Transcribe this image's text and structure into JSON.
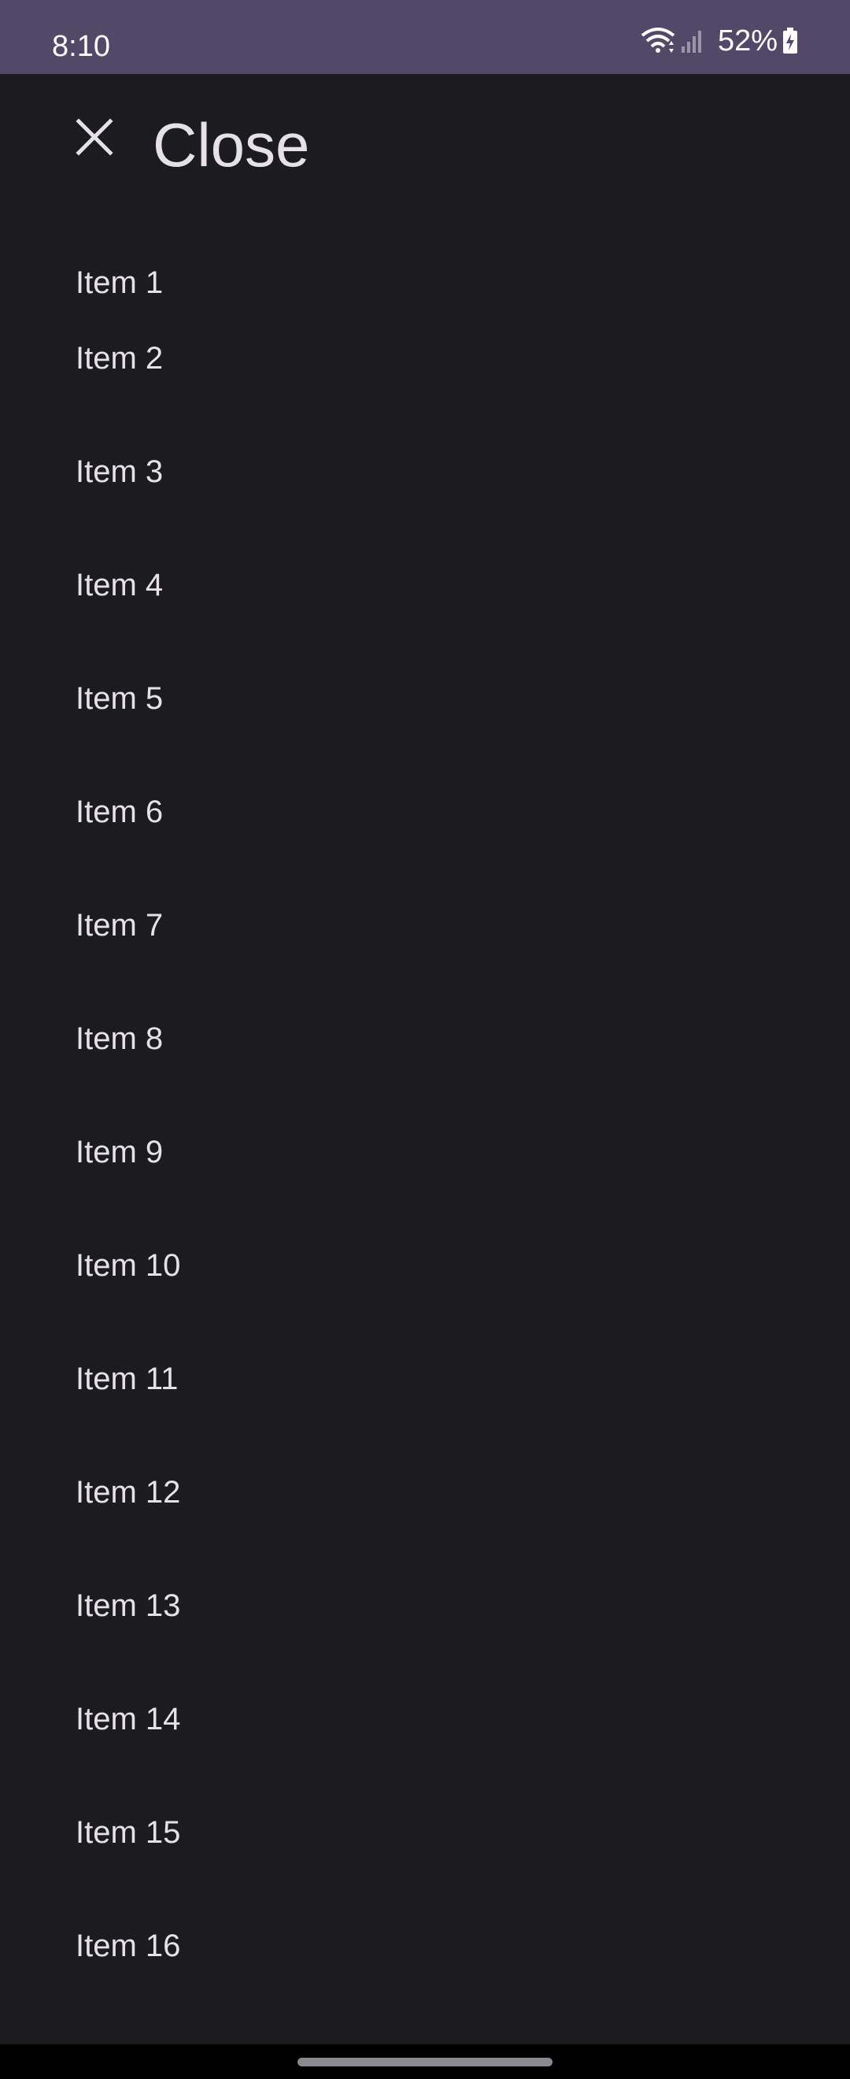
{
  "status_bar": {
    "time": "8:10",
    "battery": "52%",
    "icons": [
      "wifi-icon",
      "signal-icon",
      "battery-charging-icon"
    ]
  },
  "app_bar": {
    "close_icon": "close-icon",
    "title": "Close"
  },
  "items": [
    {
      "label": "Item 1"
    },
    {
      "label": "Item 2"
    },
    {
      "label": "Item 3"
    },
    {
      "label": "Item 4"
    },
    {
      "label": "Item 5"
    },
    {
      "label": "Item 6"
    },
    {
      "label": "Item 7"
    },
    {
      "label": "Item 8"
    },
    {
      "label": "Item 9"
    },
    {
      "label": "Item 10"
    },
    {
      "label": "Item 11"
    },
    {
      "label": "Item 12"
    },
    {
      "label": "Item 13"
    },
    {
      "label": "Item 14"
    },
    {
      "label": "Item 15"
    },
    {
      "label": "Item 16"
    }
  ],
  "colors": {
    "status_bar": "#524968",
    "background": "#1c1b20",
    "text": "#e6e1e9"
  }
}
